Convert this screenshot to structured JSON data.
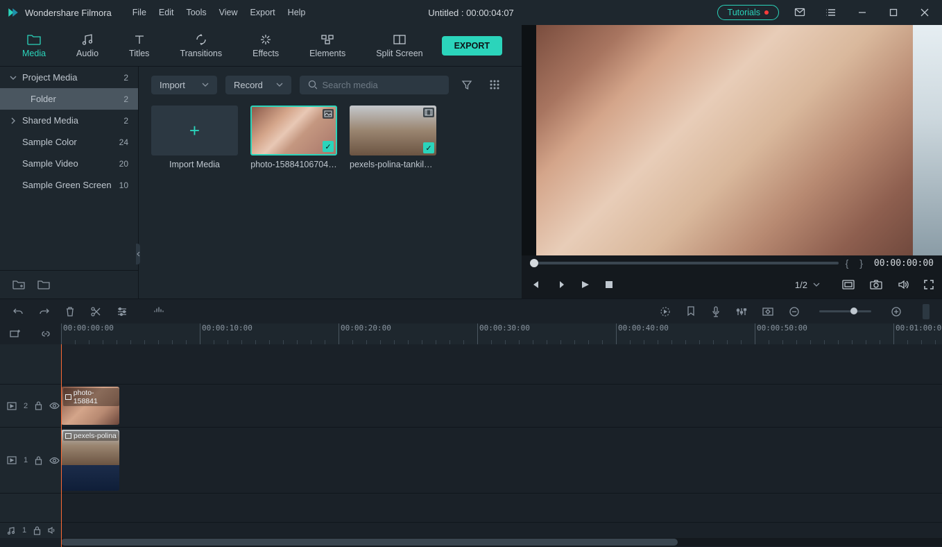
{
  "app": {
    "title": "Wondershare Filmora"
  },
  "menus": [
    "File",
    "Edit",
    "Tools",
    "View",
    "Export",
    "Help"
  ],
  "project": {
    "title": "Untitled :  00:00:04:07"
  },
  "tutorials_label": "Tutorials",
  "tabs": [
    {
      "label": "Media",
      "icon": "folder"
    },
    {
      "label": "Audio",
      "icon": "music"
    },
    {
      "label": "Titles",
      "icon": "text"
    },
    {
      "label": "Transitions",
      "icon": "transition"
    },
    {
      "label": "Effects",
      "icon": "sparkle"
    },
    {
      "label": "Elements",
      "icon": "elements"
    },
    {
      "label": "Split Screen",
      "icon": "split"
    }
  ],
  "export_label": "EXPORT",
  "sidebar": {
    "items": [
      {
        "label": "Project Media",
        "count": "2",
        "arrow": "down"
      },
      {
        "label": "Folder",
        "count": "2",
        "selected": true,
        "indent": true
      },
      {
        "label": "Shared Media",
        "count": "2",
        "arrow": "right"
      },
      {
        "label": "Sample Color",
        "count": "24",
        "indent": true
      },
      {
        "label": "Sample Video",
        "count": "20",
        "indent": true
      },
      {
        "label": "Sample Green Screen",
        "count": "10",
        "indent": true
      }
    ]
  },
  "import_dropdown": "Import",
  "record_dropdown": "Record",
  "search_placeholder": "Search media",
  "thumbs": [
    {
      "label": "Import Media",
      "type": "import"
    },
    {
      "label": "photo-15884106704…",
      "type": "image",
      "selected": true
    },
    {
      "label": "pexels-polina-tankilevi…",
      "type": "video"
    }
  ],
  "preview": {
    "timecode": "00:00:00:00",
    "braces": "{    }",
    "zoom": "1/2"
  },
  "ruler": {
    "marks": [
      "00:00:00:00",
      "00:00:10:00",
      "00:00:20:00",
      "00:00:30:00",
      "00:00:40:00",
      "00:00:50:00",
      "00:01:00:0"
    ]
  },
  "tracks": {
    "v2": {
      "label": "2",
      "clip": "photo-158841"
    },
    "v1": {
      "label": "1",
      "clip": "pexels-polina"
    },
    "a1": {
      "label": "1"
    }
  }
}
